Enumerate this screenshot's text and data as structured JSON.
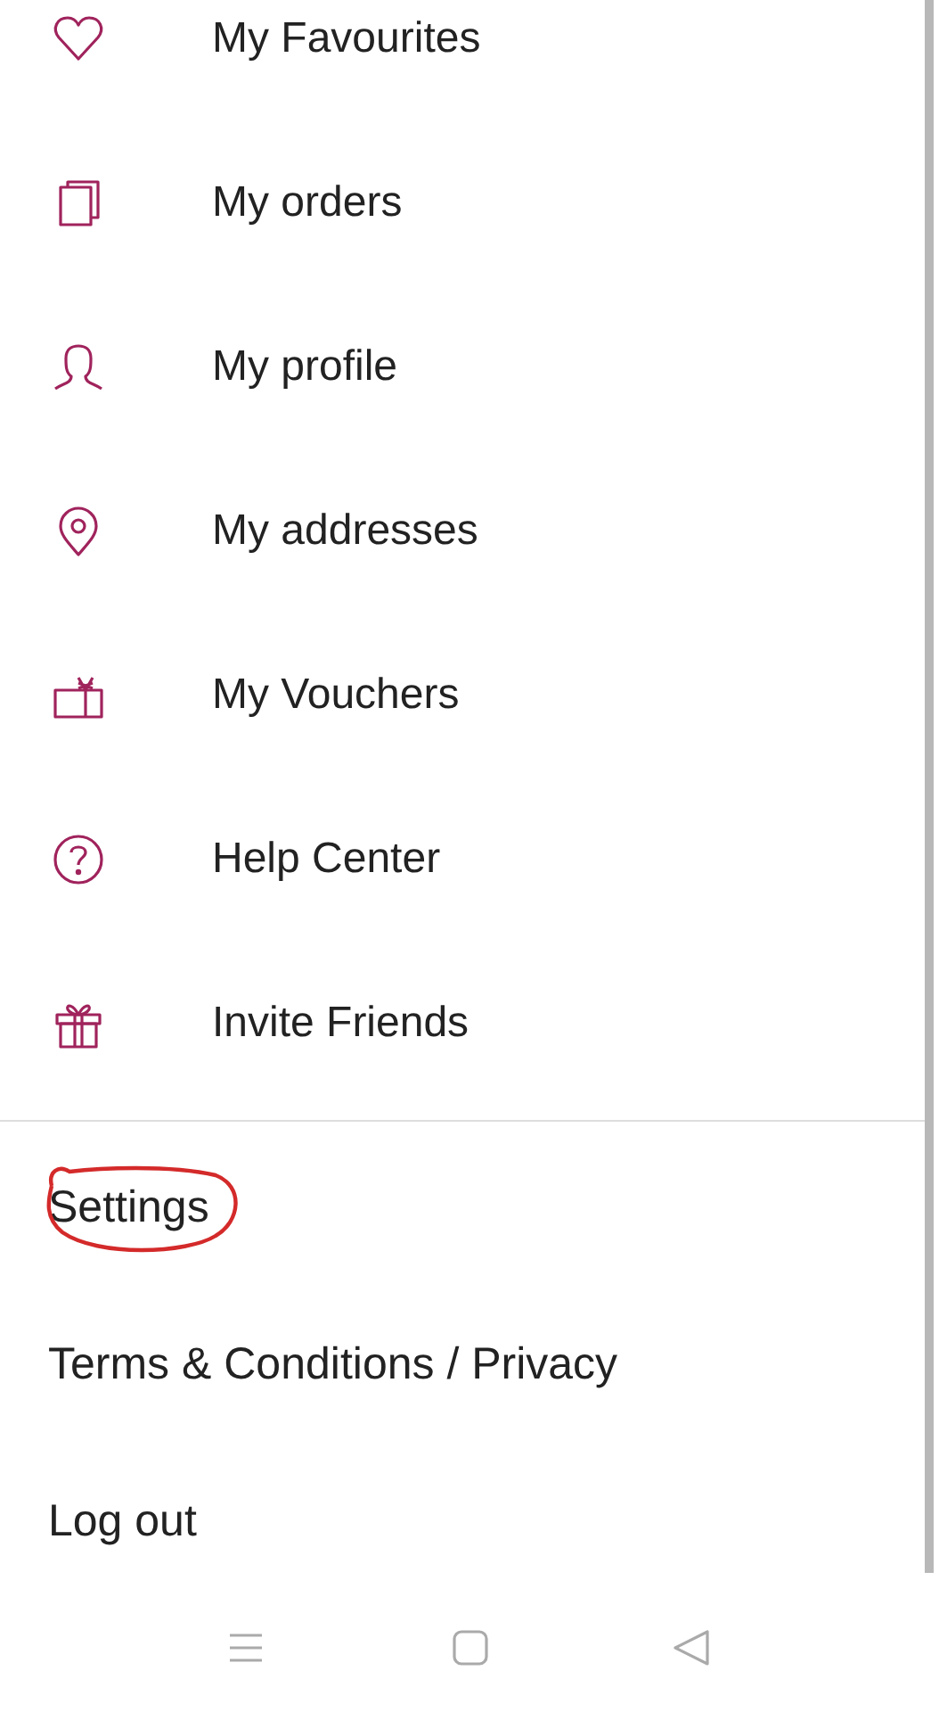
{
  "menu": {
    "items": [
      {
        "label": "My Favourites"
      },
      {
        "label": "My orders"
      },
      {
        "label": "My profile"
      },
      {
        "label": "My addresses"
      },
      {
        "label": "My Vouchers"
      },
      {
        "label": "Help Center"
      },
      {
        "label": "Invite Friends"
      }
    ]
  },
  "footer_menu": {
    "items": [
      {
        "label": "Settings",
        "circled": true
      },
      {
        "label": "Terms & Conditions / Privacy",
        "circled": false
      },
      {
        "label": "Log out",
        "circled": false
      }
    ]
  }
}
